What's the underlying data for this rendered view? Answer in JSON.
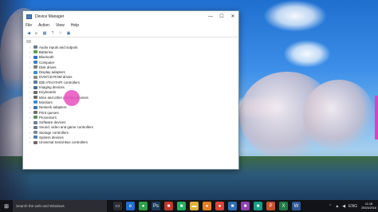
{
  "window": {
    "title": "Device Manager",
    "min_label": "—",
    "max_label": "☐",
    "close_label": "✕"
  },
  "menu": [
    "File",
    "Action",
    "View",
    "Help"
  ],
  "toolbar": {
    "back": "◀",
    "forward": "▶",
    "properties": "▦",
    "help": "?",
    "scan": "⟳",
    "display": "▣"
  },
  "tree": {
    "chevron": "›",
    "items": [
      {
        "label": "Audio inputs and outputs",
        "icon": "speaker-icon",
        "color": "#6b7b8c"
      },
      {
        "label": "Batteries",
        "icon": "battery-icon",
        "color": "#5f9e4c"
      },
      {
        "label": "Bluetooth",
        "icon": "bluetooth-icon",
        "color": "#2e6fd1"
      },
      {
        "label": "Computer",
        "icon": "computer-icon",
        "color": "#3d7fc4"
      },
      {
        "label": "Disk drives",
        "icon": "disk-icon",
        "color": "#7d7d7d"
      },
      {
        "label": "Display adapters",
        "icon": "display-icon",
        "color": "#3f8bcf"
      },
      {
        "label": "DVD/CD-ROM drives",
        "icon": "dvd-icon",
        "color": "#8a8a8a"
      },
      {
        "label": "IDE ATA/ATAPI controllers",
        "icon": "controller-icon",
        "color": "#5b7a99"
      },
      {
        "label": "Imaging devices",
        "icon": "camera-icon",
        "color": "#4a6e8f"
      },
      {
        "label": "Keyboards",
        "icon": "keyboard-icon",
        "color": "#6c6c6c"
      },
      {
        "label": "Mice and other pointing devices",
        "icon": "mouse-icon",
        "color": "#6a6a6a"
      },
      {
        "label": "Monitors",
        "icon": "monitor-icon",
        "color": "#3f8bcf"
      },
      {
        "label": "Network adapters",
        "icon": "network-icon",
        "color": "#3b75b5"
      },
      {
        "label": "Print queues",
        "icon": "printer-icon",
        "color": "#707070"
      },
      {
        "label": "Processors",
        "icon": "processor-icon",
        "color": "#5f8f5f"
      },
      {
        "label": "Software devices",
        "icon": "software-icon",
        "color": "#6d7f93"
      },
      {
        "label": "Sound, video and game controllers",
        "icon": "sound-icon",
        "color": "#6b7b8c"
      },
      {
        "label": "Storage controllers",
        "icon": "storage-icon",
        "color": "#7a8a9a"
      },
      {
        "label": "System devices",
        "icon": "system-icon",
        "color": "#4f7fae"
      },
      {
        "label": "Universal Serial Bus controllers",
        "icon": "usb-icon",
        "color": "#6d6d6d"
      }
    ]
  },
  "taskbar": {
    "search_placeholder": "Search the web and Windows",
    "apps": [
      {
        "icon": "task-view-icon",
        "glyph": "▭",
        "color": "#2b2d33"
      },
      {
        "icon": "edge-icon",
        "glyph": "e",
        "color": "#1e6fd0"
      },
      {
        "icon": "chrome-icon",
        "glyph": "●",
        "color": "#2e9e4a"
      },
      {
        "icon": "photoshop-icon",
        "glyph": "Ps",
        "color": "#1d3b5c"
      },
      {
        "icon": "app-icon-red",
        "glyph": "■",
        "color": "#c0392b"
      },
      {
        "icon": "app-icon-green",
        "glyph": "■",
        "color": "#27ae60"
      },
      {
        "icon": "folder-icon",
        "glyph": "▬",
        "color": "#e0b23a"
      },
      {
        "icon": "app-icon-orange",
        "glyph": "●",
        "color": "#e67e22"
      },
      {
        "icon": "chrome-icon-2",
        "glyph": "●",
        "color": "#db4437"
      },
      {
        "icon": "app-icon-blue",
        "glyph": "■",
        "color": "#2c6fb7"
      },
      {
        "icon": "app-icon-purple",
        "glyph": "■",
        "color": "#8e44ad"
      },
      {
        "icon": "app-icon-teal",
        "glyph": "■",
        "color": "#16a085"
      },
      {
        "icon": "powerpoint-icon",
        "glyph": "P",
        "color": "#c8512b"
      },
      {
        "icon": "excel-icon",
        "glyph": "X",
        "color": "#1f7a44"
      },
      {
        "icon": "word-icon",
        "glyph": "W",
        "color": "#2b5797"
      }
    ],
    "lang": "ENG",
    "time": "11:18",
    "date": "25/03/2016"
  }
}
